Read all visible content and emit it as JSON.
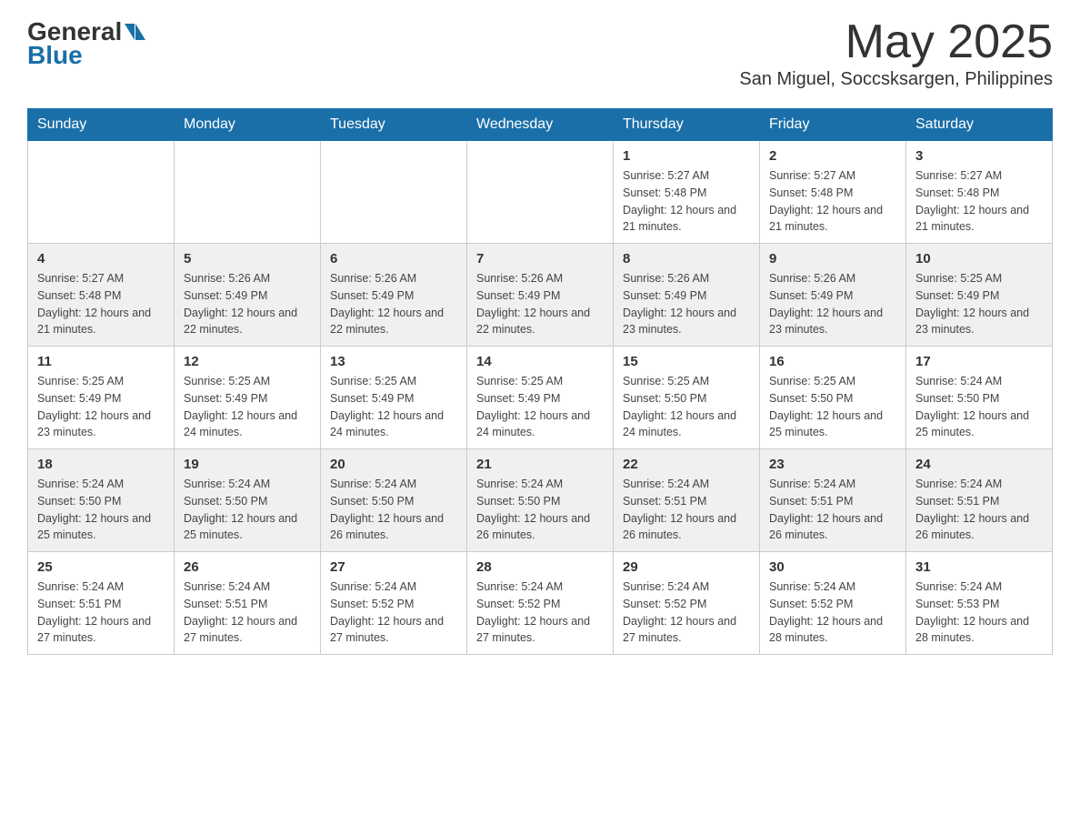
{
  "header": {
    "logo_general": "General",
    "logo_blue": "Blue",
    "month_title": "May 2025",
    "location": "San Miguel, Soccsksargen, Philippines"
  },
  "days_of_week": [
    "Sunday",
    "Monday",
    "Tuesday",
    "Wednesday",
    "Thursday",
    "Friday",
    "Saturday"
  ],
  "weeks": [
    [
      {
        "num": "",
        "sunrise": "",
        "sunset": "",
        "daylight": "",
        "empty": true
      },
      {
        "num": "",
        "sunrise": "",
        "sunset": "",
        "daylight": "",
        "empty": true
      },
      {
        "num": "",
        "sunrise": "",
        "sunset": "",
        "daylight": "",
        "empty": true
      },
      {
        "num": "",
        "sunrise": "",
        "sunset": "",
        "daylight": "",
        "empty": true
      },
      {
        "num": "1",
        "sunrise": "Sunrise: 5:27 AM",
        "sunset": "Sunset: 5:48 PM",
        "daylight": "Daylight: 12 hours and 21 minutes.",
        "empty": false
      },
      {
        "num": "2",
        "sunrise": "Sunrise: 5:27 AM",
        "sunset": "Sunset: 5:48 PM",
        "daylight": "Daylight: 12 hours and 21 minutes.",
        "empty": false
      },
      {
        "num": "3",
        "sunrise": "Sunrise: 5:27 AM",
        "sunset": "Sunset: 5:48 PM",
        "daylight": "Daylight: 12 hours and 21 minutes.",
        "empty": false
      }
    ],
    [
      {
        "num": "4",
        "sunrise": "Sunrise: 5:27 AM",
        "sunset": "Sunset: 5:48 PM",
        "daylight": "Daylight: 12 hours and 21 minutes.",
        "empty": false
      },
      {
        "num": "5",
        "sunrise": "Sunrise: 5:26 AM",
        "sunset": "Sunset: 5:49 PM",
        "daylight": "Daylight: 12 hours and 22 minutes.",
        "empty": false
      },
      {
        "num": "6",
        "sunrise": "Sunrise: 5:26 AM",
        "sunset": "Sunset: 5:49 PM",
        "daylight": "Daylight: 12 hours and 22 minutes.",
        "empty": false
      },
      {
        "num": "7",
        "sunrise": "Sunrise: 5:26 AM",
        "sunset": "Sunset: 5:49 PM",
        "daylight": "Daylight: 12 hours and 22 minutes.",
        "empty": false
      },
      {
        "num": "8",
        "sunrise": "Sunrise: 5:26 AM",
        "sunset": "Sunset: 5:49 PM",
        "daylight": "Daylight: 12 hours and 23 minutes.",
        "empty": false
      },
      {
        "num": "9",
        "sunrise": "Sunrise: 5:26 AM",
        "sunset": "Sunset: 5:49 PM",
        "daylight": "Daylight: 12 hours and 23 minutes.",
        "empty": false
      },
      {
        "num": "10",
        "sunrise": "Sunrise: 5:25 AM",
        "sunset": "Sunset: 5:49 PM",
        "daylight": "Daylight: 12 hours and 23 minutes.",
        "empty": false
      }
    ],
    [
      {
        "num": "11",
        "sunrise": "Sunrise: 5:25 AM",
        "sunset": "Sunset: 5:49 PM",
        "daylight": "Daylight: 12 hours and 23 minutes.",
        "empty": false
      },
      {
        "num": "12",
        "sunrise": "Sunrise: 5:25 AM",
        "sunset": "Sunset: 5:49 PM",
        "daylight": "Daylight: 12 hours and 24 minutes.",
        "empty": false
      },
      {
        "num": "13",
        "sunrise": "Sunrise: 5:25 AM",
        "sunset": "Sunset: 5:49 PM",
        "daylight": "Daylight: 12 hours and 24 minutes.",
        "empty": false
      },
      {
        "num": "14",
        "sunrise": "Sunrise: 5:25 AM",
        "sunset": "Sunset: 5:49 PM",
        "daylight": "Daylight: 12 hours and 24 minutes.",
        "empty": false
      },
      {
        "num": "15",
        "sunrise": "Sunrise: 5:25 AM",
        "sunset": "Sunset: 5:50 PM",
        "daylight": "Daylight: 12 hours and 24 minutes.",
        "empty": false
      },
      {
        "num": "16",
        "sunrise": "Sunrise: 5:25 AM",
        "sunset": "Sunset: 5:50 PM",
        "daylight": "Daylight: 12 hours and 25 minutes.",
        "empty": false
      },
      {
        "num": "17",
        "sunrise": "Sunrise: 5:24 AM",
        "sunset": "Sunset: 5:50 PM",
        "daylight": "Daylight: 12 hours and 25 minutes.",
        "empty": false
      }
    ],
    [
      {
        "num": "18",
        "sunrise": "Sunrise: 5:24 AM",
        "sunset": "Sunset: 5:50 PM",
        "daylight": "Daylight: 12 hours and 25 minutes.",
        "empty": false
      },
      {
        "num": "19",
        "sunrise": "Sunrise: 5:24 AM",
        "sunset": "Sunset: 5:50 PM",
        "daylight": "Daylight: 12 hours and 25 minutes.",
        "empty": false
      },
      {
        "num": "20",
        "sunrise": "Sunrise: 5:24 AM",
        "sunset": "Sunset: 5:50 PM",
        "daylight": "Daylight: 12 hours and 26 minutes.",
        "empty": false
      },
      {
        "num": "21",
        "sunrise": "Sunrise: 5:24 AM",
        "sunset": "Sunset: 5:50 PM",
        "daylight": "Daylight: 12 hours and 26 minutes.",
        "empty": false
      },
      {
        "num": "22",
        "sunrise": "Sunrise: 5:24 AM",
        "sunset": "Sunset: 5:51 PM",
        "daylight": "Daylight: 12 hours and 26 minutes.",
        "empty": false
      },
      {
        "num": "23",
        "sunrise": "Sunrise: 5:24 AM",
        "sunset": "Sunset: 5:51 PM",
        "daylight": "Daylight: 12 hours and 26 minutes.",
        "empty": false
      },
      {
        "num": "24",
        "sunrise": "Sunrise: 5:24 AM",
        "sunset": "Sunset: 5:51 PM",
        "daylight": "Daylight: 12 hours and 26 minutes.",
        "empty": false
      }
    ],
    [
      {
        "num": "25",
        "sunrise": "Sunrise: 5:24 AM",
        "sunset": "Sunset: 5:51 PM",
        "daylight": "Daylight: 12 hours and 27 minutes.",
        "empty": false
      },
      {
        "num": "26",
        "sunrise": "Sunrise: 5:24 AM",
        "sunset": "Sunset: 5:51 PM",
        "daylight": "Daylight: 12 hours and 27 minutes.",
        "empty": false
      },
      {
        "num": "27",
        "sunrise": "Sunrise: 5:24 AM",
        "sunset": "Sunset: 5:52 PM",
        "daylight": "Daylight: 12 hours and 27 minutes.",
        "empty": false
      },
      {
        "num": "28",
        "sunrise": "Sunrise: 5:24 AM",
        "sunset": "Sunset: 5:52 PM",
        "daylight": "Daylight: 12 hours and 27 minutes.",
        "empty": false
      },
      {
        "num": "29",
        "sunrise": "Sunrise: 5:24 AM",
        "sunset": "Sunset: 5:52 PM",
        "daylight": "Daylight: 12 hours and 27 minutes.",
        "empty": false
      },
      {
        "num": "30",
        "sunrise": "Sunrise: 5:24 AM",
        "sunset": "Sunset: 5:52 PM",
        "daylight": "Daylight: 12 hours and 28 minutes.",
        "empty": false
      },
      {
        "num": "31",
        "sunrise": "Sunrise: 5:24 AM",
        "sunset": "Sunset: 5:53 PM",
        "daylight": "Daylight: 12 hours and 28 minutes.",
        "empty": false
      }
    ]
  ]
}
